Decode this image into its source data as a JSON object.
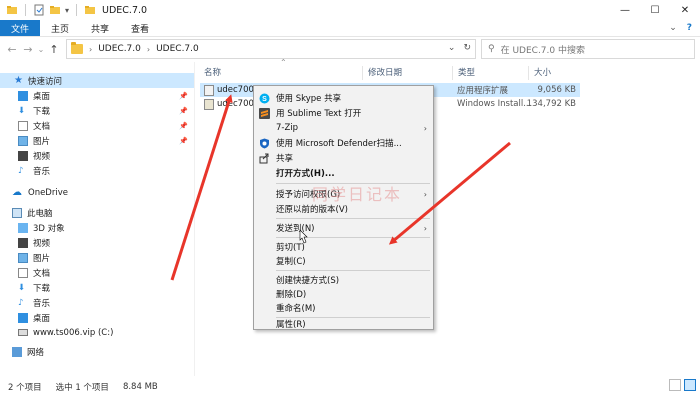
{
  "window": {
    "title": "UDEC.7.0"
  },
  "ribbon": {
    "tabs": [
      {
        "label": "文件",
        "active": true
      },
      {
        "label": "主页",
        "active": false
      },
      {
        "label": "共享",
        "active": false
      },
      {
        "label": "查看",
        "active": false
      }
    ]
  },
  "address": {
    "crumbs": [
      "UDEC.7.0",
      "UDEC.7.0"
    ],
    "search_placeholder": "在 UDEC.7.0 中搜索"
  },
  "sidebar": {
    "quick_access": "快速访问",
    "quick_items": [
      "桌面",
      "下载",
      "文档",
      "图片",
      "视频",
      "音乐"
    ],
    "onedrive": "OneDrive",
    "this_pc": "此电脑",
    "pc_items": [
      "3D 对象",
      "视频",
      "图片",
      "文档",
      "下载",
      "音乐",
      "桌面",
      "www.ts006.vip (C:)"
    ],
    "network": "网络"
  },
  "columns": {
    "name": "名称",
    "modified": "修改日期",
    "type": "类型",
    "size": "大小"
  },
  "files": [
    {
      "name": "udec700.e",
      "type": "应用程序扩展",
      "size": "9,056 KB",
      "selected": true
    },
    {
      "name": "udec700_",
      "type": "Windows Install...",
      "size": "134,792 KB",
      "selected": false
    }
  ],
  "context_menu": {
    "items": [
      {
        "label": "使用 Skype 共享",
        "icon": "skype-icon"
      },
      {
        "label": "用 Sublime Text 打开",
        "icon": "sublime-icon"
      },
      {
        "label": "7-Zip",
        "icon": "",
        "submenu": true
      },
      {
        "label": "使用 Microsoft Defender扫描...",
        "icon": "defender-icon"
      },
      {
        "label": "共享",
        "icon": "share-icon"
      },
      {
        "label": "打开方式(H)...",
        "bold": true
      },
      {
        "label": "授予访问权限(G)",
        "submenu": true
      },
      {
        "label": "还原以前的版本(V)"
      },
      {
        "label": "发送到(N)",
        "submenu": true
      },
      {
        "label": "剪切(T)"
      },
      {
        "label": "复制(C)"
      },
      {
        "label": "创建快捷方式(S)"
      },
      {
        "label": "删除(D)"
      },
      {
        "label": "重命名(M)"
      },
      {
        "label": "属性(R)"
      }
    ]
  },
  "status": {
    "count": "2 个项目",
    "selected": "选中 1 个项目",
    "size": "8.84 MB"
  },
  "watermark": "同学日记本",
  "colors": {
    "accent": "#1979ca",
    "selection": "#cce8ff",
    "annotation_arrow": "#e8352a"
  }
}
